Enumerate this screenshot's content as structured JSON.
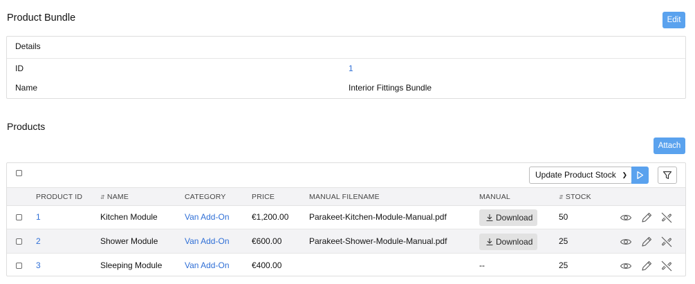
{
  "bundle": {
    "title": "Product Bundle",
    "edit_label": "Edit",
    "details_heading": "Details",
    "fields": [
      {
        "label": "ID",
        "value": "1"
      },
      {
        "label": "Name",
        "value": "Interior Fittings Bundle"
      }
    ]
  },
  "products": {
    "title": "Products",
    "attach_label": "Attach",
    "action_select": "Update Product Stock",
    "columns": [
      "PRODUCT ID",
      "NAME",
      "CATEGORY",
      "PRICE",
      "MANUAL FILENAME",
      "MANUAL",
      "STOCK"
    ],
    "download_label": "Download",
    "rows": [
      {
        "id": "1",
        "name": "Kitchen Module",
        "category": "Van Add-On",
        "price": "€1,200.00",
        "filename": "Parakeet-Kitchen-Module-Manual.pdf",
        "manual": "Download",
        "stock": "50"
      },
      {
        "id": "2",
        "name": "Shower Module",
        "category": "Van Add-On",
        "price": "€600.00",
        "filename": "Parakeet-Shower-Module-Manual.pdf",
        "manual": "Download",
        "stock": "25"
      },
      {
        "id": "3",
        "name": "Sleeping Module",
        "category": "Van Add-On",
        "price": "€400.00",
        "filename": "",
        "manual": "--",
        "stock": "25"
      }
    ]
  },
  "colors": {
    "accent": "#5aa2ee",
    "link": "#2f6fd6",
    "header_bg": "#f3f3f5"
  },
  "icons": [
    "download-icon",
    "view-icon",
    "edit-icon",
    "detach-icon",
    "filter-icon",
    "run-icon",
    "sort-icon",
    "chevron-down-icon"
  ]
}
